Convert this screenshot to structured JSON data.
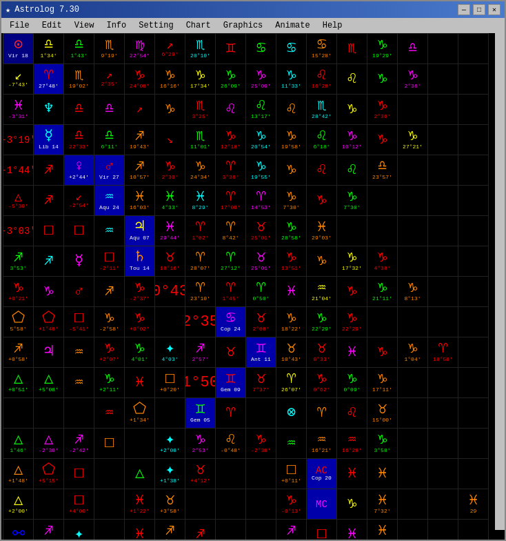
{
  "window": {
    "title": "Astrolog 7.30",
    "icon": "★"
  },
  "menu": {
    "items": [
      "File",
      "Edit",
      "View",
      "Info",
      "Setting",
      "Chart",
      "Graphics",
      "Animate",
      "Help"
    ]
  },
  "titleControls": [
    "—",
    "□",
    "✕"
  ],
  "grid": {
    "cells": [
      {
        "row": 0,
        "col": 0,
        "symbol": "⊙",
        "color": "#ff0000",
        "bg": "#000080",
        "text": "Vir 18",
        "subtext": ""
      },
      {
        "row": 0,
        "col": 1,
        "symbol": "♎",
        "color": "#ffff00",
        "bg": "#000",
        "text": "1°34'",
        "subtext": ""
      },
      {
        "row": 0,
        "col": 2,
        "symbol": "♎",
        "color": "#00ff00",
        "bg": "#000",
        "text": "1°43'",
        "subtext": ""
      },
      {
        "row": 0,
        "col": 3,
        "symbol": "♏",
        "color": "#ff8800",
        "bg": "#000",
        "text": "9°19'",
        "subtext": ""
      },
      {
        "row": 0,
        "col": 4,
        "symbol": "♍",
        "color": "#ff00ff",
        "bg": "#000",
        "text": "22°54'",
        "subtext": ""
      },
      {
        "row": 0,
        "col": 5,
        "symbol": "↗",
        "color": "#ff0000",
        "bg": "#000",
        "text": "6°29'",
        "subtext": ""
      },
      {
        "row": 0,
        "col": 6,
        "symbol": "♏",
        "color": "#00ffff",
        "bg": "#000",
        "text": "",
        "subtext": "20°10'"
      },
      {
        "row": 0,
        "col": 7,
        "symbol": "♊",
        "color": "#ff0000",
        "bg": "#000",
        "text": "",
        "subtext": ""
      },
      {
        "row": 0,
        "col": 8,
        "symbol": "♋",
        "color": "#00ff00",
        "bg": "#000",
        "text": "",
        "subtext": ""
      },
      {
        "row": 0,
        "col": 9,
        "symbol": "♋",
        "color": "#00ffff",
        "bg": "#000",
        "text": "",
        "subtext": ""
      },
      {
        "row": 0,
        "col": 10,
        "symbol": "♋",
        "color": "#ff8800",
        "bg": "#000",
        "text": "",
        "subtext": "15°28'"
      },
      {
        "row": 0,
        "col": 11,
        "symbol": "♏",
        "color": "#ff0000",
        "bg": "#000",
        "text": "",
        "subtext": ""
      },
      {
        "row": 0,
        "col": 12,
        "symbol": "♑",
        "color": "#00ff00",
        "bg": "#000",
        "text": "",
        "subtext": "19°29'"
      },
      {
        "row": 0,
        "col": 13,
        "symbol": "♎",
        "color": "#ff00ff",
        "bg": "#000",
        "text": "",
        "subtext": ""
      }
    ]
  }
}
